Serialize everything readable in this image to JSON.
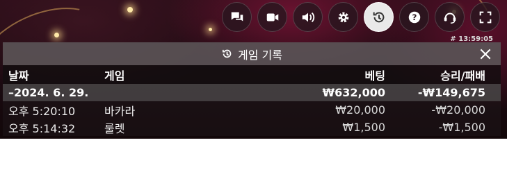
{
  "clock": "# 13:59:05",
  "controls": [
    {
      "icon": "chat-icon"
    },
    {
      "icon": "video-camera-icon"
    },
    {
      "icon": "volume-icon"
    },
    {
      "icon": "gear-icon"
    },
    {
      "icon": "history-icon",
      "active": true
    },
    {
      "icon": "help-icon"
    },
    {
      "icon": "headset-icon"
    },
    {
      "icon": "fullscreen-icon"
    }
  ],
  "history": {
    "title": "게임 기록",
    "columns": {
      "date": "날짜",
      "game": "게임",
      "bet": "베팅",
      "result": "승리/패배"
    },
    "date_group": {
      "date": "–2024. 6. 29.",
      "bet": "₩632,000",
      "result": "-₩149,675"
    },
    "entries": [
      {
        "time": "오후 5:20:10",
        "game": "바카라",
        "bet": "₩20,000",
        "result": "-₩20,000"
      },
      {
        "time": "오후 5:14:32",
        "game": "룰렛",
        "bet": "₩1,500",
        "result": "-₩1,500"
      }
    ]
  },
  "colors": {
    "panel_header": "#5a5256",
    "active_control": "#e9e9e9",
    "text": "#ffffff"
  }
}
